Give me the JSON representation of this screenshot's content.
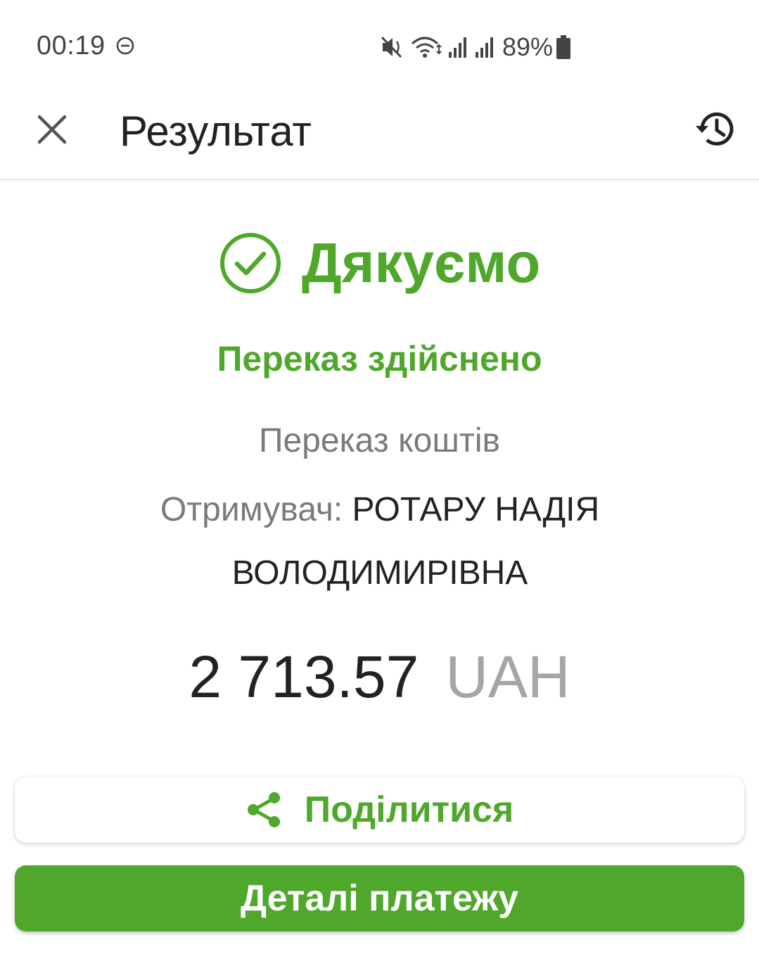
{
  "status_bar": {
    "time": "00:19",
    "battery": "89%",
    "icons": [
      "do-not-disturb-icon",
      "mute-icon",
      "wifi-icon",
      "signal-icon",
      "signal-icon",
      "battery-icon"
    ]
  },
  "app_bar": {
    "title": "Результат",
    "left_icon": "close-icon",
    "right_icon": "history-icon"
  },
  "result": {
    "headline": "Дякуємо",
    "status": "Переказ здійснено",
    "operation": "Переказ коштів",
    "recipient_label": "Отримувач:",
    "recipient_name": "РОТАРУ НАДІЯ ВОЛОДИМИРІВНА",
    "amount": "2 713.57",
    "currency": "UAH"
  },
  "actions": {
    "share_label": "Поділитися",
    "details_label": "Деталі платежу"
  },
  "colors": {
    "accent": "#4fa72c",
    "text_primary": "#222222",
    "text_secondary": "#7a7a7a",
    "currency": "#a5a5a5"
  }
}
